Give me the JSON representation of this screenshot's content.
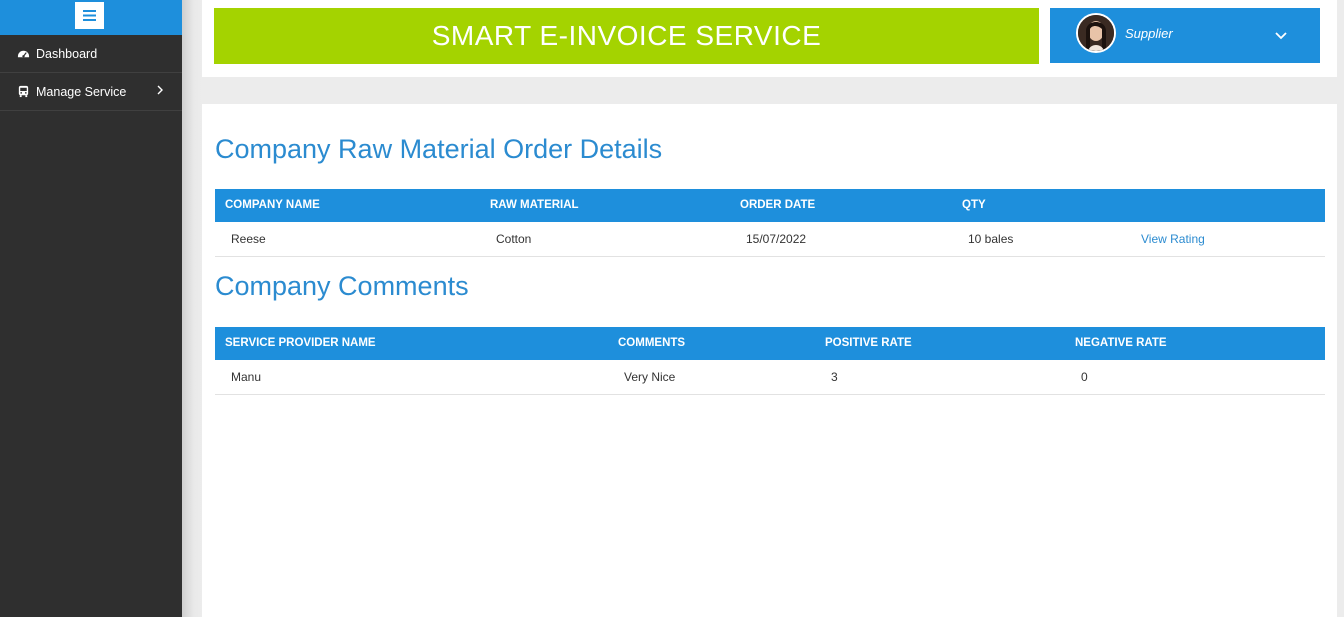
{
  "sidebar": {
    "items": [
      {
        "label": "Dashboard",
        "icon": "dashboard-icon"
      },
      {
        "label": "Manage Service",
        "icon": "bus-icon"
      }
    ]
  },
  "header": {
    "title": "SMART E-INVOICE SERVICE",
    "user_role": "Supplier"
  },
  "orders": {
    "title": "Company Raw Material Order Details",
    "columns": [
      "COMPANY NAME",
      "RAW MATERIAL",
      "ORDER DATE",
      "QTY"
    ],
    "rows": [
      {
        "company": "Reese",
        "material": "Cotton",
        "date": "15/07/2022",
        "qty": "10 bales",
        "action": "View Rating"
      }
    ]
  },
  "comments": {
    "title": "Company Comments",
    "columns": [
      "SERVICE PROVIDER NAME",
      "COMMENTS",
      "POSITIVE RATE",
      "NEGATIVE RATE"
    ],
    "rows": [
      {
        "provider": "Manu",
        "comment": "Very Nice",
        "positive": "3",
        "negative": "0"
      }
    ]
  },
  "colors": {
    "primary": "#1e8fdc",
    "banner": "#a4d300",
    "sidebar": "#2f2f2f",
    "heading": "#2b8bd0"
  }
}
